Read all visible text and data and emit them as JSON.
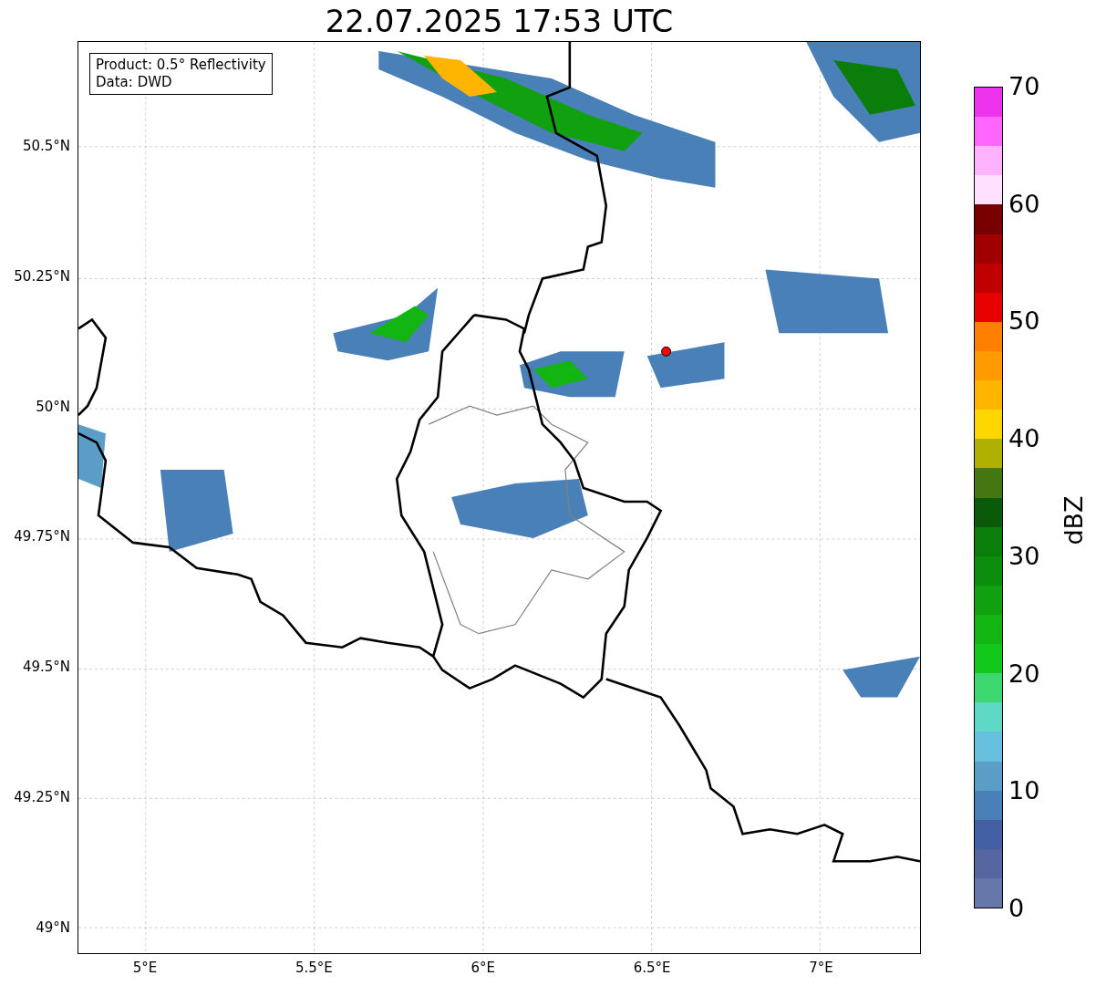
{
  "title": "22.07.2025 17:53 UTC",
  "legend": [
    "Product: 0.5° Reflectivity",
    "Data: DWD"
  ],
  "y_ticks": [
    "50.5°N",
    "50.25°N",
    "50°N",
    "49.75°N",
    "49.5°N",
    "49.25°N",
    "49°N"
  ],
  "x_ticks": [
    "5°E",
    "5.5°E",
    "6°E",
    "6.5°E",
    "7°E"
  ],
  "colorbar": {
    "label": "dBZ",
    "ticks": [
      "70",
      "60",
      "50",
      "40",
      "30",
      "20",
      "10",
      "0"
    ],
    "segments": [
      {
        "color": "#ee33ee"
      },
      {
        "color": "#ff66ff"
      },
      {
        "color": "#ffb3ff"
      },
      {
        "color": "#ffe0ff"
      },
      {
        "color": "#780000"
      },
      {
        "color": "#a00000"
      },
      {
        "color": "#c00000"
      },
      {
        "color": "#e60000"
      },
      {
        "color": "#ff7f00"
      },
      {
        "color": "#ff9a00"
      },
      {
        "color": "#ffb400"
      },
      {
        "color": "#ffd700"
      },
      {
        "color": "#b0b000"
      },
      {
        "color": "#447711"
      },
      {
        "color": "#0a5a0a"
      },
      {
        "color": "#0b7d0b"
      },
      {
        "color": "#0d8d0d"
      },
      {
        "color": "#10a010"
      },
      {
        "color": "#12b512"
      },
      {
        "color": "#12c81a"
      },
      {
        "color": "#3dd870"
      },
      {
        "color": "#60d8c8"
      },
      {
        "color": "#66c0dd"
      },
      {
        "color": "#5a9ec8"
      },
      {
        "color": "#4a80b8"
      },
      {
        "color": "#4460a5"
      },
      {
        "color": "#5566a0"
      },
      {
        "color": "#6677aa"
      }
    ]
  }
}
